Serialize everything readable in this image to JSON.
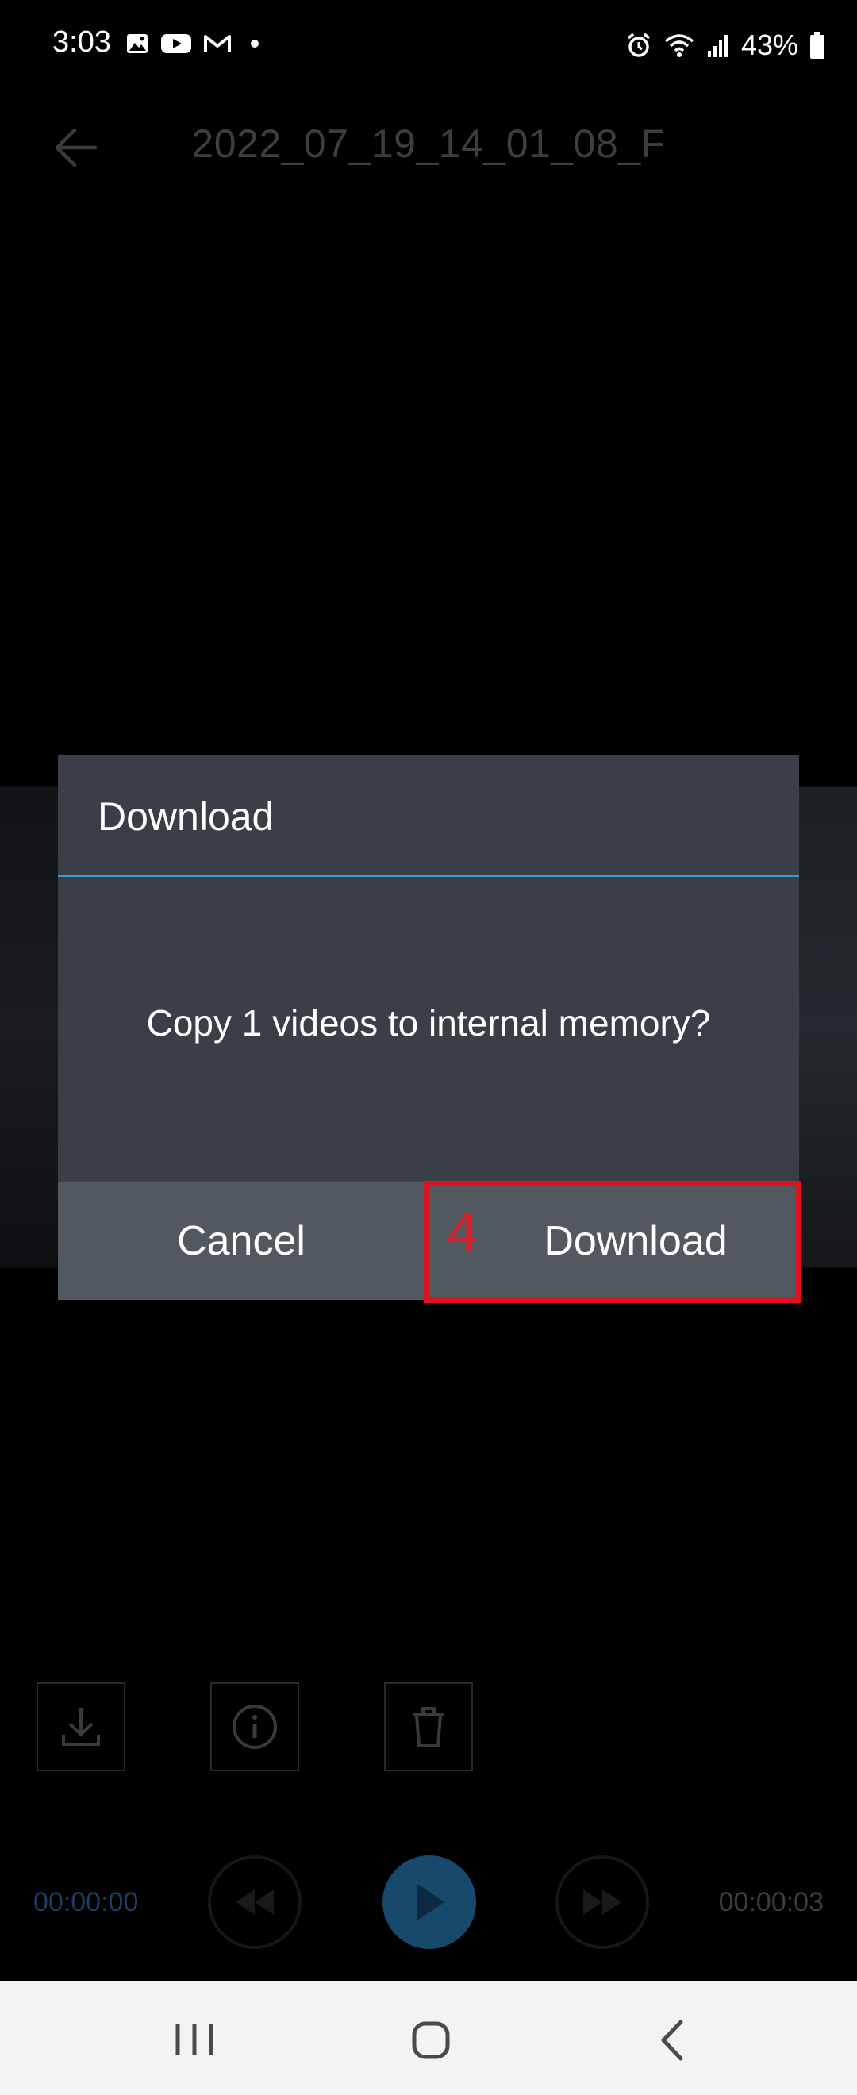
{
  "status_bar": {
    "time": "3:03",
    "battery_percent": "43%",
    "notification_icons": [
      "gallery-icon",
      "youtube-icon",
      "gmail-icon",
      "dot-icon"
    ],
    "system_icons": [
      "alarm-icon",
      "wifi-icon",
      "signal-icon",
      "battery-icon"
    ]
  },
  "app_bar": {
    "title": "2022_07_19_14_01_08_F"
  },
  "dialog": {
    "title": "Download",
    "message": "Copy 1 videos to internal memory?",
    "cancel_label": "Cancel",
    "download_label": "Download",
    "step_number": "4",
    "accent_color": "#3a9ad9",
    "highlight_color": "#e0101f"
  },
  "actions": {
    "icons": [
      "download-icon",
      "info-icon",
      "trash-icon"
    ]
  },
  "player": {
    "current_time": "00:00:00",
    "total_time": "00:00:03"
  }
}
